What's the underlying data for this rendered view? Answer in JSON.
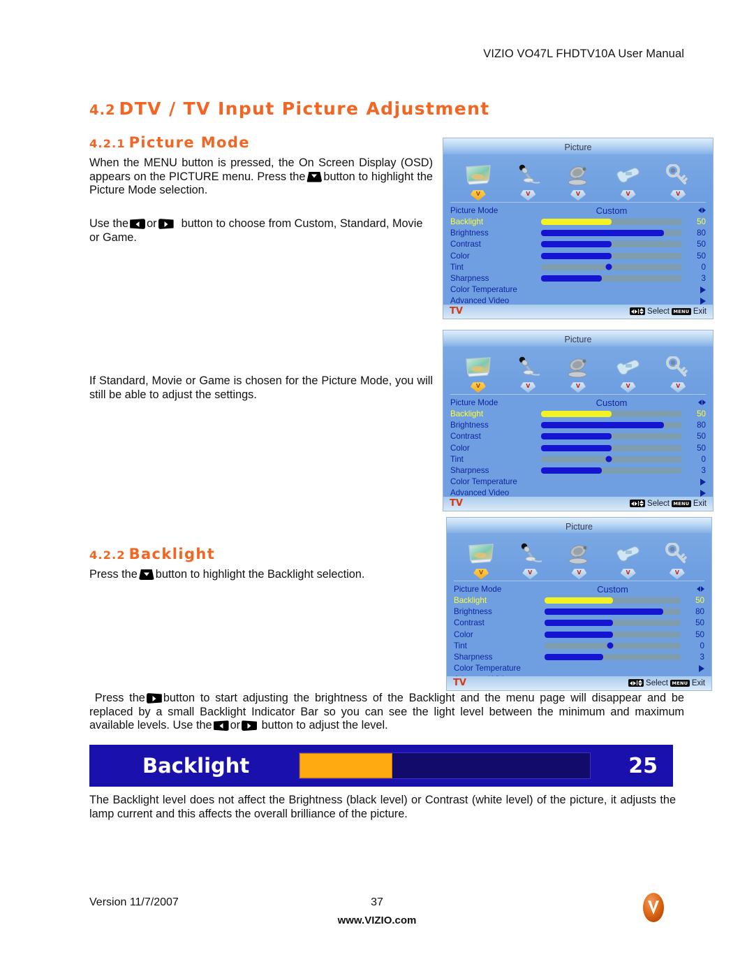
{
  "header": {
    "title": "VIZIO VO47L FHDTV10A User Manual"
  },
  "headings": {
    "main_num": "4.2",
    "main_text": "DTV / TV Input Picture Adjustment",
    "sub1_num": "4.2.1",
    "sub1_text": "Picture Mode",
    "sub2_num": "4.2.2",
    "sub2_text": "Backlight"
  },
  "paragraphs": {
    "intro_a": "When the MENU button is pressed, the On Screen Display (OSD) appears on the PICTURE menu.  Press the",
    "intro_b": "button to highlight the Picture Mode selection.",
    "use_a": "Use the",
    "use_or": "or",
    "use_b": "button to choose from Custom, Standard, Movie or Game.",
    "standard": "If Standard, Movie or Game is chosen for the Picture Mode, you will still be able to adjust the settings.",
    "press_backlight_a": "Press the",
    "press_backlight_b": "button to highlight the Backlight selection.",
    "adjusting_a": "Press the",
    "adjusting_b": "button to start adjusting the brightness of the Backlight and the menu page will disappear and be replaced by a small Backlight Indicator Bar so you can see the light level between the minimum and maximum available levels.  Use the",
    "adjusting_or": "or",
    "adjusting_c": "button to adjust the level.",
    "not_affect": "The Backlight level does not affect the Brightness (black level) or Contrast (white level) of the picture, it adjusts the lamp current and this affects the overall brilliance of the picture."
  },
  "osd": {
    "title": "Picture",
    "tabs": [
      {
        "icon": "tv-screen-icon",
        "name": "picture-tab",
        "active": true
      },
      {
        "icon": "microphone-icon",
        "name": "audio-tab",
        "active": false
      },
      {
        "icon": "satellite-dish-icon",
        "name": "tuner-tab",
        "active": false
      },
      {
        "icon": "wrench-icon",
        "name": "setup-tab",
        "active": false
      },
      {
        "icon": "key-icon",
        "name": "parental-tab",
        "active": false
      }
    ],
    "tab_badge_letter": "V",
    "rows": [
      {
        "label": "Picture Mode",
        "type": "mode",
        "value": "Custom",
        "selected": false
      },
      {
        "label": "Backlight",
        "type": "bar",
        "value": "50",
        "fill": 50,
        "color": "yellow",
        "selected": true
      },
      {
        "label": "Brightness",
        "type": "bar",
        "value": "80",
        "fill": 87,
        "color": "blue",
        "selected": false
      },
      {
        "label": "Contrast",
        "type": "bar",
        "value": "50",
        "fill": 50,
        "color": "blue",
        "selected": false
      },
      {
        "label": "Color",
        "type": "bar",
        "value": "50",
        "fill": 50,
        "color": "blue",
        "selected": false
      },
      {
        "label": "Tint",
        "type": "knob",
        "value": "0",
        "fill": 48,
        "color": "blue",
        "selected": false
      },
      {
        "label": "Sharpness",
        "type": "bar",
        "value": "3",
        "fill": 43,
        "color": "blue",
        "selected": false
      },
      {
        "label": "Color Temperature",
        "type": "submenu",
        "value": "",
        "selected": false
      },
      {
        "label": "Advanced Video",
        "type": "submenu",
        "value": "",
        "selected": false
      }
    ],
    "footer": {
      "source": "TV",
      "select_label": "Select",
      "menu_key": "MENU",
      "exit_label": "Exit"
    }
  },
  "backlight_indicator": {
    "label": "Backlight",
    "value": "25",
    "fill_percent": 32,
    "bar_color": "#FFAA11",
    "background_color": "#1a10ab"
  },
  "footer": {
    "version": "Version 11/7/2007",
    "page_number": "37",
    "url": "www.VIZIO.com",
    "logo": "vizio-logo"
  },
  "colors": {
    "heading_orange": "#F26522",
    "osd_blue": "#6f9fe0",
    "osd_text_blue": "#10239e",
    "osd_highlight_yellow": "#ffff33",
    "osd_source_red": "#d63a10"
  }
}
